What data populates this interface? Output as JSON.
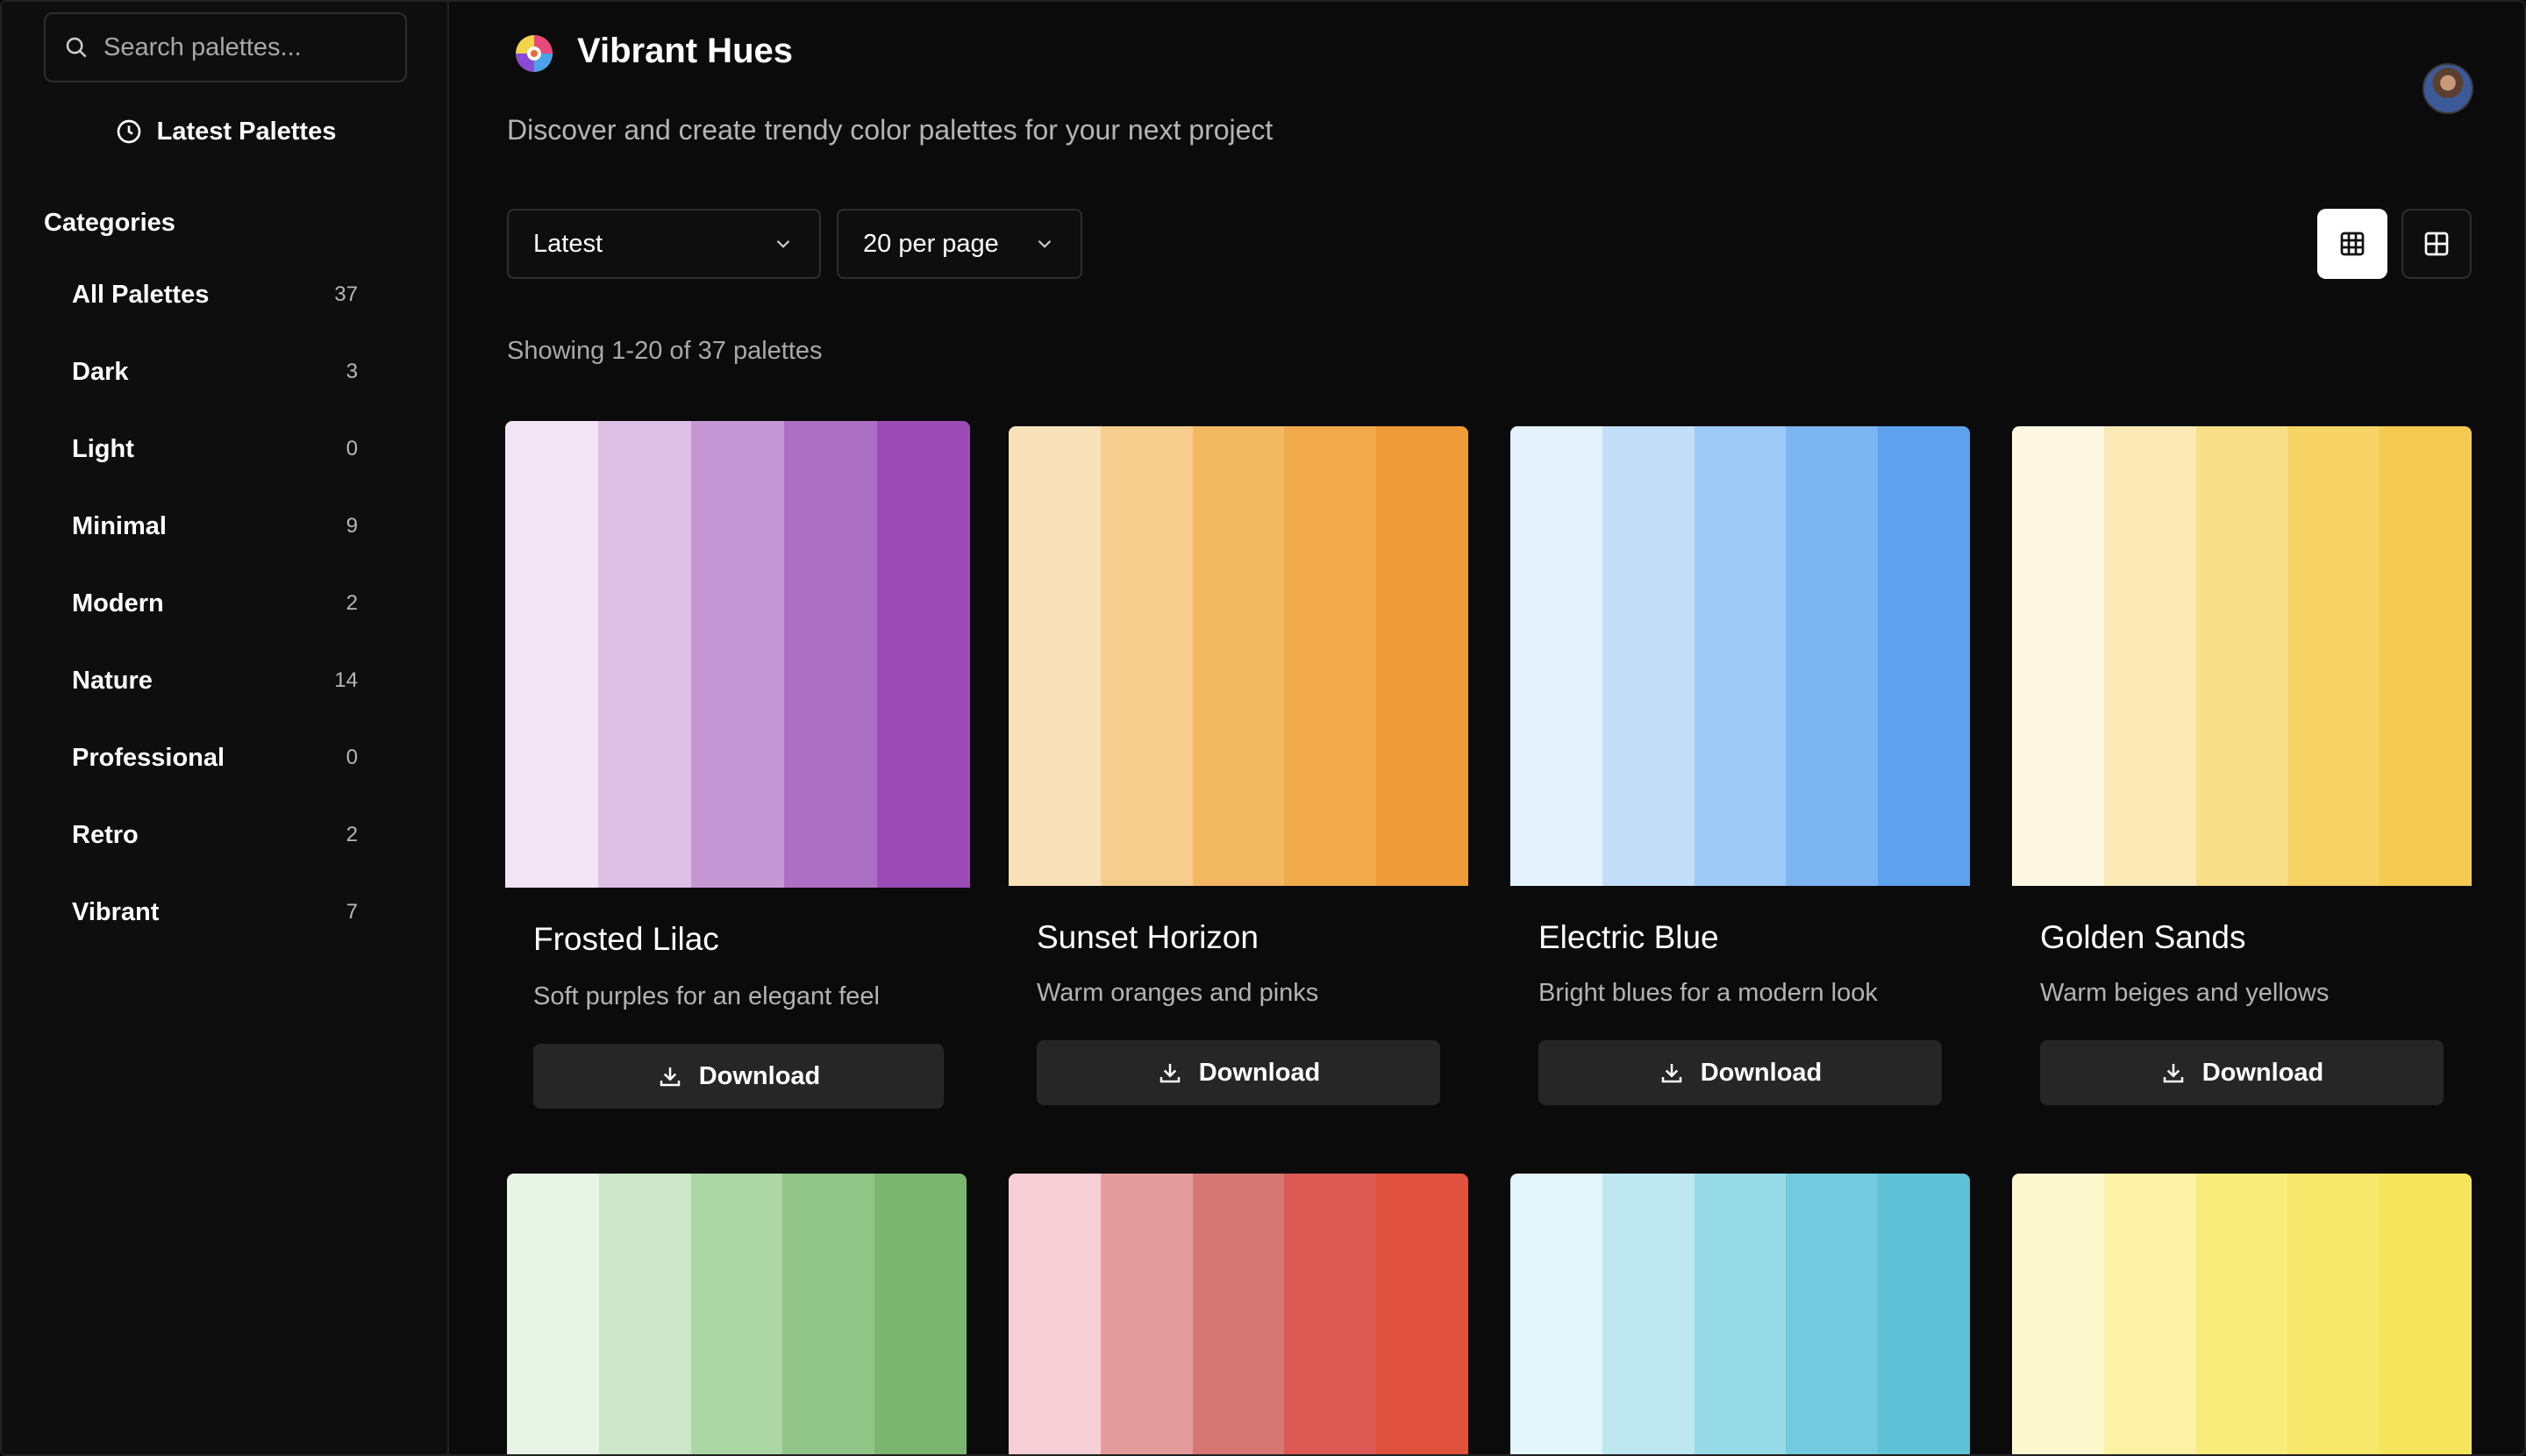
{
  "sidebar": {
    "search_placeholder": "Search palettes...",
    "latest_label": "Latest Palettes",
    "categories_heading": "Categories",
    "categories": [
      {
        "label": "All Palettes",
        "count": "37"
      },
      {
        "label": "Dark",
        "count": "3"
      },
      {
        "label": "Light",
        "count": "0"
      },
      {
        "label": "Minimal",
        "count": "9"
      },
      {
        "label": "Modern",
        "count": "2"
      },
      {
        "label": "Nature",
        "count": "14"
      },
      {
        "label": "Professional",
        "count": "0"
      },
      {
        "label": "Retro",
        "count": "2"
      },
      {
        "label": "Vibrant",
        "count": "7"
      }
    ]
  },
  "header": {
    "title": "Vibrant Hues",
    "subtitle": "Discover and create trendy color palettes for your next project"
  },
  "controls": {
    "sort_value": "Latest",
    "per_page_value": "20 per page"
  },
  "results": {
    "showing_text": "Showing 1-20 of 37 palettes"
  },
  "download_label": "Download",
  "palettes": [
    {
      "name": "Frosted Lilac",
      "description": "Soft purples for an elegant feel",
      "colors": [
        "#f0e4f5",
        "#dcc0e6",
        "#c697d5",
        "#ad6fc4",
        "#9b4cb5"
      ]
    },
    {
      "name": "Sunset Horizon",
      "description": "Warm oranges and pinks",
      "colors": [
        "#f9e2b9",
        "#f6cd8c",
        "#f2b862",
        "#f1aa4b",
        "#ef9b37"
      ]
    },
    {
      "name": "Electric Blue",
      "description": "Bright blues for a modern look",
      "colors": [
        "#e4f2fd",
        "#c2def9",
        "#9ecaf7",
        "#7bb5f2",
        "#5ea2ee"
      ]
    },
    {
      "name": "Golden Sands",
      "description": "Warm beiges and yellows",
      "colors": [
        "#fef7e2",
        "#fbeab5",
        "#f8de87",
        "#f6d364",
        "#f5ca50"
      ]
    },
    {
      "colors": [
        "#e8f4e6",
        "#cde5c9",
        "#acd5a6",
        "#92c588",
        "#7bb670"
      ]
    },
    {
      "colors": [
        "#f6ced6",
        "#e39c9b",
        "#d57875",
        "#dc5a53",
        "#e0523e"
      ]
    },
    {
      "colors": [
        "#e2f5fa",
        "#bde8ef",
        "#98dbe8",
        "#71cadd",
        "#5ec1d6"
      ]
    },
    {
      "colors": [
        "#fdf8ce",
        "#fbf2a5",
        "#f8ec7a",
        "#f6e86a",
        "#f5e55c"
      ]
    }
  ]
}
